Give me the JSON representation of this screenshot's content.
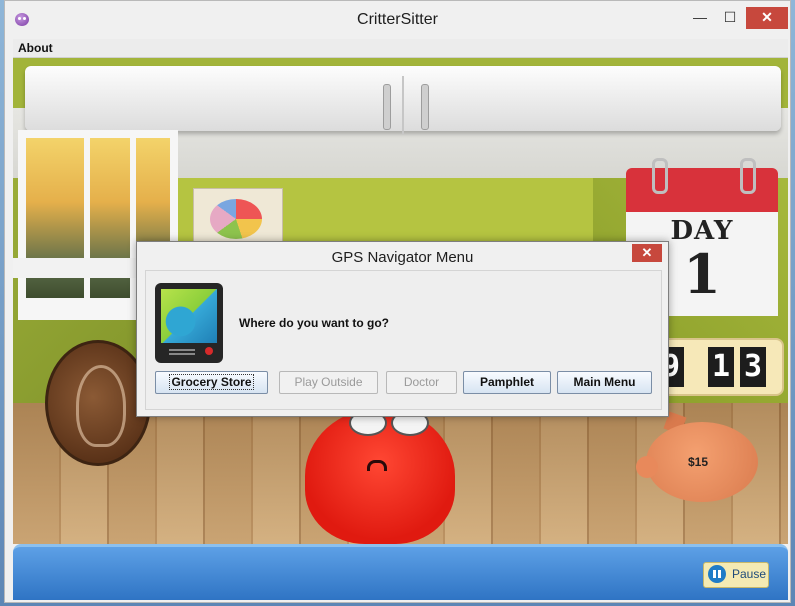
{
  "window": {
    "title": "CritterSitter",
    "controls": {
      "minimize": "—",
      "maximize": "☐",
      "close": "✕"
    }
  },
  "menubar": {
    "items": [
      "About"
    ]
  },
  "scene": {
    "calendar": {
      "label": "DAY",
      "day": "1"
    },
    "clock": {
      "digits": [
        "9",
        "1",
        "3"
      ]
    },
    "piggy_bank": {
      "money": "$15"
    }
  },
  "dialog": {
    "title": "GPS Navigator Menu",
    "close": "✕",
    "icon": "gps-navigator-icon",
    "prompt": "Where do you want to go?",
    "buttons": [
      {
        "label": "Grocery Store",
        "enabled": true,
        "focused": true
      },
      {
        "label": "Play Outside",
        "enabled": false
      },
      {
        "label": "Doctor",
        "enabled": false
      },
      {
        "label": "Pamphlet",
        "enabled": true
      },
      {
        "label": "Main Menu",
        "enabled": true
      }
    ]
  },
  "bottom_bar": {
    "pause_label": "Pause"
  },
  "colors": {
    "accent": "#2f74c4",
    "close_red": "#c7483d",
    "critter": "#e01a10"
  }
}
